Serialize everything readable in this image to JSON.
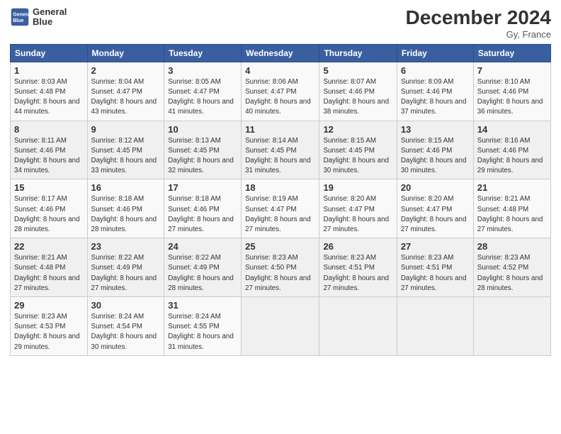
{
  "header": {
    "logo_line1": "General",
    "logo_line2": "Blue",
    "month_title": "December 2024",
    "location": "Gy, France"
  },
  "days_of_week": [
    "Sunday",
    "Monday",
    "Tuesday",
    "Wednesday",
    "Thursday",
    "Friday",
    "Saturday"
  ],
  "weeks": [
    [
      {
        "num": "1",
        "sunrise": "8:03 AM",
        "sunset": "4:48 PM",
        "daylight": "8 hours and 44 minutes."
      },
      {
        "num": "2",
        "sunrise": "8:04 AM",
        "sunset": "4:47 PM",
        "daylight": "8 hours and 43 minutes."
      },
      {
        "num": "3",
        "sunrise": "8:05 AM",
        "sunset": "4:47 PM",
        "daylight": "8 hours and 41 minutes."
      },
      {
        "num": "4",
        "sunrise": "8:06 AM",
        "sunset": "4:47 PM",
        "daylight": "8 hours and 40 minutes."
      },
      {
        "num": "5",
        "sunrise": "8:07 AM",
        "sunset": "4:46 PM",
        "daylight": "8 hours and 38 minutes."
      },
      {
        "num": "6",
        "sunrise": "8:09 AM",
        "sunset": "4:46 PM",
        "daylight": "8 hours and 37 minutes."
      },
      {
        "num": "7",
        "sunrise": "8:10 AM",
        "sunset": "4:46 PM",
        "daylight": "8 hours and 36 minutes."
      }
    ],
    [
      {
        "num": "8",
        "sunrise": "8:11 AM",
        "sunset": "4:46 PM",
        "daylight": "8 hours and 34 minutes."
      },
      {
        "num": "9",
        "sunrise": "8:12 AM",
        "sunset": "4:45 PM",
        "daylight": "8 hours and 33 minutes."
      },
      {
        "num": "10",
        "sunrise": "8:13 AM",
        "sunset": "4:45 PM",
        "daylight": "8 hours and 32 minutes."
      },
      {
        "num": "11",
        "sunrise": "8:14 AM",
        "sunset": "4:45 PM",
        "daylight": "8 hours and 31 minutes."
      },
      {
        "num": "12",
        "sunrise": "8:15 AM",
        "sunset": "4:45 PM",
        "daylight": "8 hours and 30 minutes."
      },
      {
        "num": "13",
        "sunrise": "8:15 AM",
        "sunset": "4:46 PM",
        "daylight": "8 hours and 30 minutes."
      },
      {
        "num": "14",
        "sunrise": "8:16 AM",
        "sunset": "4:46 PM",
        "daylight": "8 hours and 29 minutes."
      }
    ],
    [
      {
        "num": "15",
        "sunrise": "8:17 AM",
        "sunset": "4:46 PM",
        "daylight": "8 hours and 28 minutes."
      },
      {
        "num": "16",
        "sunrise": "8:18 AM",
        "sunset": "4:46 PM",
        "daylight": "8 hours and 28 minutes."
      },
      {
        "num": "17",
        "sunrise": "8:18 AM",
        "sunset": "4:46 PM",
        "daylight": "8 hours and 27 minutes."
      },
      {
        "num": "18",
        "sunrise": "8:19 AM",
        "sunset": "4:47 PM",
        "daylight": "8 hours and 27 minutes."
      },
      {
        "num": "19",
        "sunrise": "8:20 AM",
        "sunset": "4:47 PM",
        "daylight": "8 hours and 27 minutes."
      },
      {
        "num": "20",
        "sunrise": "8:20 AM",
        "sunset": "4:47 PM",
        "daylight": "8 hours and 27 minutes."
      },
      {
        "num": "21",
        "sunrise": "8:21 AM",
        "sunset": "4:48 PM",
        "daylight": "8 hours and 27 minutes."
      }
    ],
    [
      {
        "num": "22",
        "sunrise": "8:21 AM",
        "sunset": "4:48 PM",
        "daylight": "8 hours and 27 minutes."
      },
      {
        "num": "23",
        "sunrise": "8:22 AM",
        "sunset": "4:49 PM",
        "daylight": "8 hours and 27 minutes."
      },
      {
        "num": "24",
        "sunrise": "8:22 AM",
        "sunset": "4:49 PM",
        "daylight": "8 hours and 28 minutes."
      },
      {
        "num": "25",
        "sunrise": "8:23 AM",
        "sunset": "4:50 PM",
        "daylight": "8 hours and 27 minutes."
      },
      {
        "num": "26",
        "sunrise": "8:23 AM",
        "sunset": "4:51 PM",
        "daylight": "8 hours and 27 minutes."
      },
      {
        "num": "27",
        "sunrise": "8:23 AM",
        "sunset": "4:51 PM",
        "daylight": "8 hours and 27 minutes."
      },
      {
        "num": "28",
        "sunrise": "8:23 AM",
        "sunset": "4:52 PM",
        "daylight": "8 hours and 28 minutes."
      }
    ],
    [
      {
        "num": "29",
        "sunrise": "8:23 AM",
        "sunset": "4:53 PM",
        "daylight": "8 hours and 29 minutes."
      },
      {
        "num": "30",
        "sunrise": "8:24 AM",
        "sunset": "4:54 PM",
        "daylight": "8 hours and 30 minutes."
      },
      {
        "num": "31",
        "sunrise": "8:24 AM",
        "sunset": "4:55 PM",
        "daylight": "8 hours and 31 minutes."
      },
      null,
      null,
      null,
      null
    ]
  ]
}
